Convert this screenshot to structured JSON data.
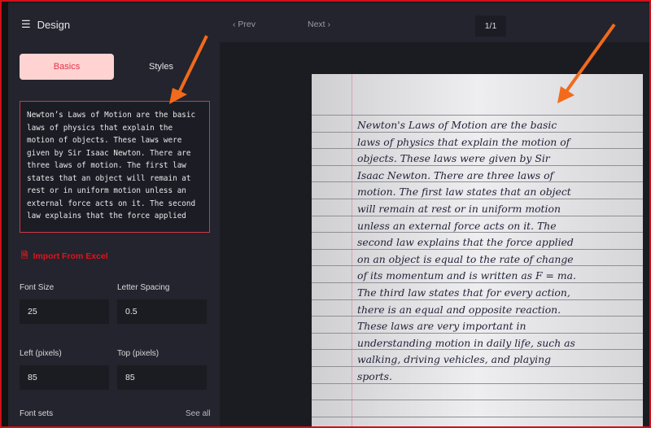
{
  "sidebar": {
    "title": "Design",
    "tabs": [
      "Basics",
      "Styles"
    ],
    "text_lines": [
      "Newton’s Laws of Motion are the basic",
      "laws of physics that explain the",
      "motion of objects. These laws were",
      "given by Sir Isaac Newton. There are",
      "three laws of motion. The first law",
      "states that an object will remain at",
      "rest or in uniform motion unless an",
      "external force acts on it. The second",
      "law explains that the force applied"
    ],
    "import_label": "Import From Excel",
    "font_size_label": "Font Size",
    "font_size": "25",
    "letter_spacing_label": "Letter Spacing",
    "letter_spacing": "0.5",
    "left_label": "Left (pixels)",
    "left": "85",
    "top_label": "Top (pixels)",
    "top": "85",
    "font_sets_label": "Font sets",
    "see_all": "See all"
  },
  "toolbar": {
    "prev": "Prev",
    "page": "1/1",
    "next": "Next"
  },
  "preview": {
    "lines": [
      "Newton's Laws of Motion are the basic",
      "laws of physics that explain the motion of",
      "objects. These laws were given by Sir",
      "Isaac Newton. There are three laws of",
      "motion. The first law states that an object",
      "will remain at rest or in uniform motion",
      "unless an external force acts on it. The",
      "second law explains that the force applied",
      "on an object is equal to the rate of change",
      "of its momentum and is written as F = ma.",
      "The third law states that for every action,",
      "there is an equal and opposite reaction.",
      "These laws are very important in",
      "understanding motion in daily life, such as",
      "walking, driving vehicles, and playing",
      "sports."
    ]
  },
  "colors": {
    "accent": "#e0344a",
    "arrow": "#f26a1b"
  }
}
